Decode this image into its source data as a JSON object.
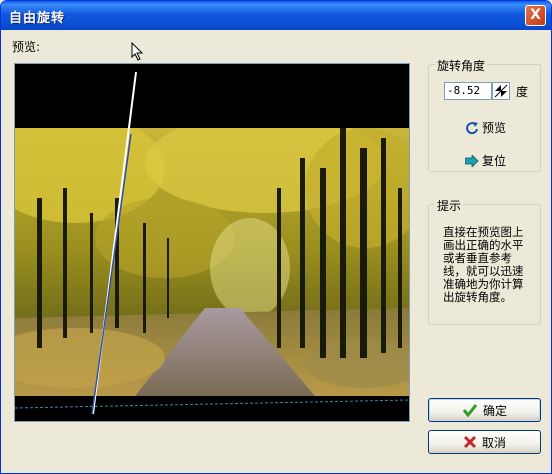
{
  "window": {
    "title": "自由旋转",
    "close_glyph": "X"
  },
  "preview": {
    "label": "预览:"
  },
  "angle_group": {
    "title": "旋转角度",
    "value": "-8.52",
    "unit": "度"
  },
  "actions": {
    "preview_label": "预览",
    "reset_label": "复位"
  },
  "hint_group": {
    "title": "提示",
    "text": "直接在预览图上画出正确的水平或者垂直参考线，就可以迅速准确地为你计算出旋转角度。"
  },
  "buttons": {
    "ok_label": "确定",
    "cancel_label": "取消"
  },
  "icons": {
    "close": "close-icon",
    "spin": "spin-arrows-icon",
    "preview": "rotate-arrow-icon",
    "reset": "right-arrow-icon",
    "ok": "checkmark-icon",
    "cancel": "x-mark-icon",
    "cursor": "mouse-pointer-icon"
  },
  "colors": {
    "titlebar": "#0a4fd3",
    "close": "#d9532d",
    "face": "#ece9d8",
    "ok_check": "#2a9d2a",
    "cancel_x": "#c1272d"
  }
}
